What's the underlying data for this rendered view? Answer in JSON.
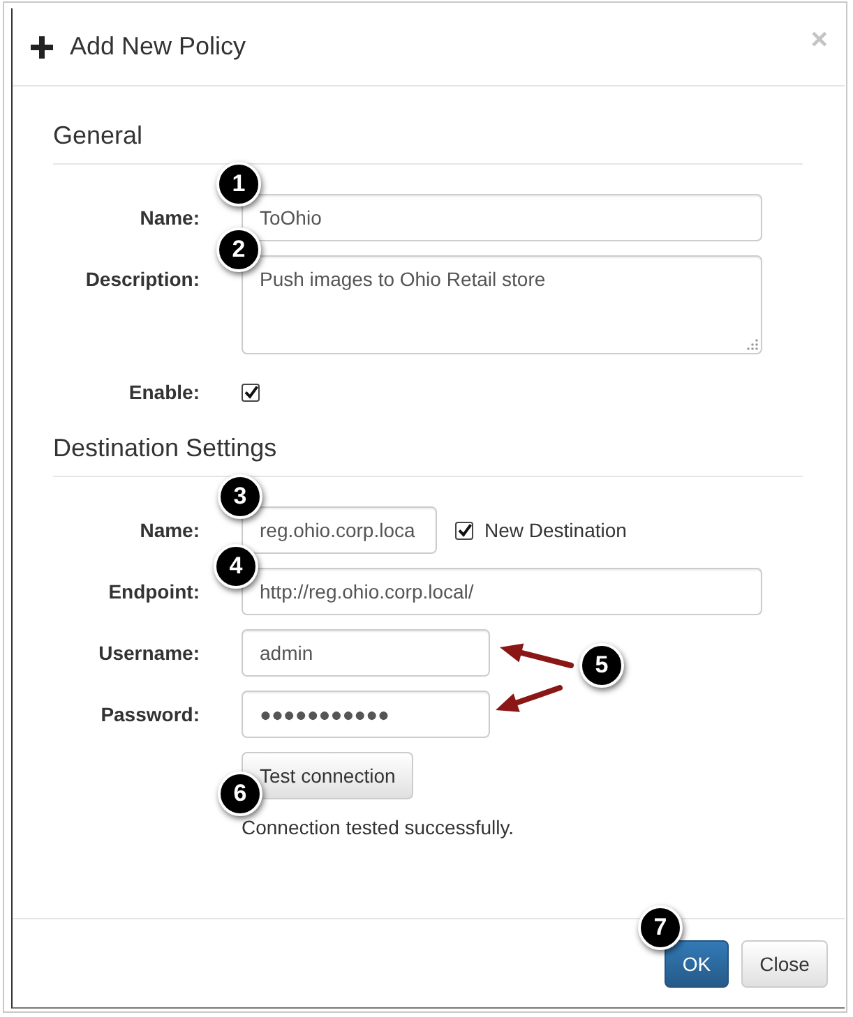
{
  "dialog": {
    "title": "Add New Policy",
    "close": "×"
  },
  "sections": [
    {
      "heading": "General",
      "fields": [
        {
          "kind": "text",
          "label": "Name:",
          "value": "ToOhio"
        },
        {
          "kind": "textarea",
          "label": "Description:",
          "value": "Push images to Ohio Retail store"
        },
        {
          "kind": "checkbox",
          "label": "Enable:",
          "checked": true
        }
      ]
    },
    {
      "heading": "Destination Settings",
      "fields": [
        {
          "kind": "text_option",
          "label": "Name:",
          "value": "reg.ohio.corp.loca",
          "option": {
            "label": "New Destination",
            "checked": true
          }
        },
        {
          "kind": "text",
          "label": "Endpoint:",
          "value": "http://reg.ohio.corp.local/"
        },
        {
          "kind": "short_text",
          "label": "Username:",
          "value": "admin"
        },
        {
          "kind": "password",
          "label": "Password:",
          "value": "●●●●●●●●●●●"
        },
        {
          "kind": "action",
          "button": "Test connection",
          "message": "Connection tested successfully."
        }
      ]
    }
  ],
  "footer": {
    "buttons": [
      {
        "label": "OK",
        "kind": "primary"
      },
      {
        "label": "Close",
        "kind": "default"
      }
    ]
  },
  "callouts": [
    {
      "label": "1",
      "kind": "badge"
    },
    {
      "label": "2",
      "kind": "badge"
    },
    {
      "label": "3",
      "kind": "badge"
    },
    {
      "label": "4",
      "kind": "badge"
    },
    {
      "label": "5",
      "kind": "arrows"
    },
    {
      "label": "6",
      "kind": "badge"
    },
    {
      "label": "7",
      "kind": "badge"
    }
  ]
}
